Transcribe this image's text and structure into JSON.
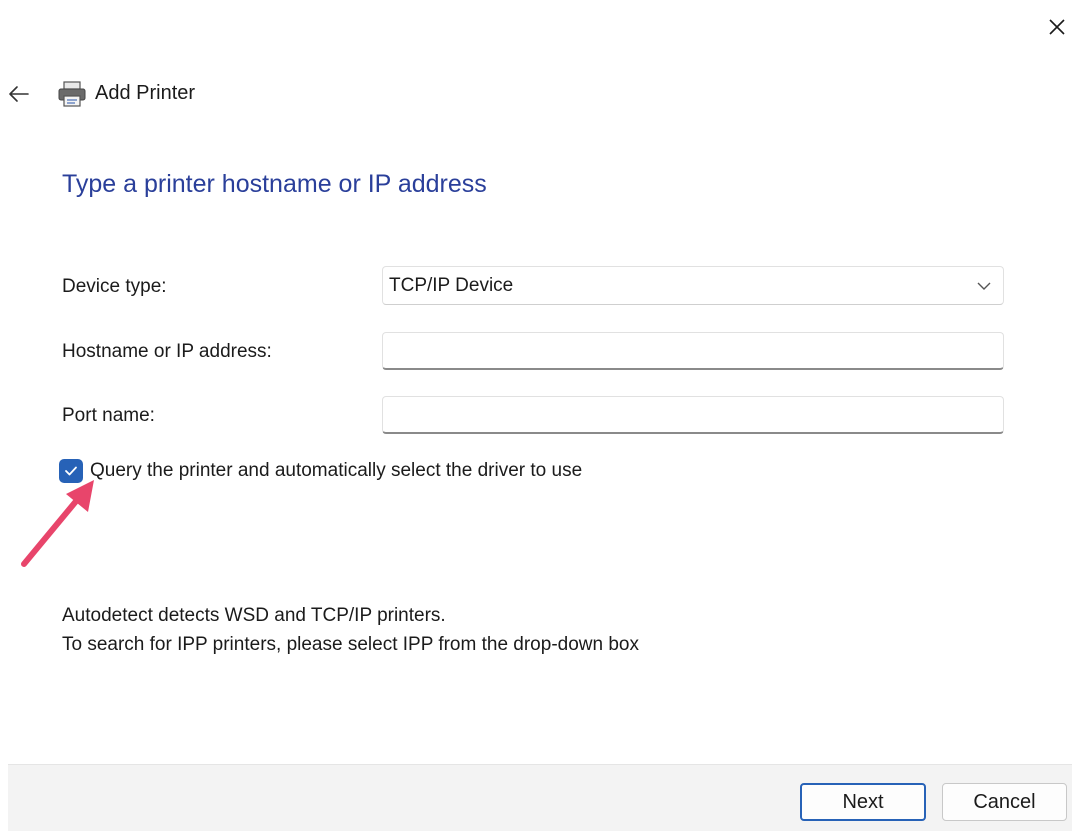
{
  "window": {
    "title": "Add Printer"
  },
  "icons": {
    "close": "close-icon",
    "back": "back-arrow-icon",
    "printer": "printer-icon",
    "chevron": "chevron-down-icon",
    "check": "check-icon",
    "annotation": "pink-arrow-annotation"
  },
  "heading": "Type a printer hostname or IP address",
  "form": {
    "device_type": {
      "label": "Device type:",
      "value": "TCP/IP Device"
    },
    "hostname": {
      "label": "Hostname or IP address:",
      "value": ""
    },
    "port": {
      "label": "Port name:",
      "value": ""
    },
    "query_checkbox": {
      "label": "Query the printer and automatically select the driver to use",
      "checked": true
    }
  },
  "info": {
    "line1": "Autodetect detects WSD and TCP/IP printers.",
    "line2": "To search for IPP printers, please select IPP from the drop-down box"
  },
  "buttons": {
    "next": "Next",
    "cancel": "Cancel"
  },
  "colors": {
    "accent": "#2762b7",
    "heading": "#2a3f9a",
    "annotation_arrow": "#e8456b",
    "footer_bg": "#f3f3f3"
  }
}
